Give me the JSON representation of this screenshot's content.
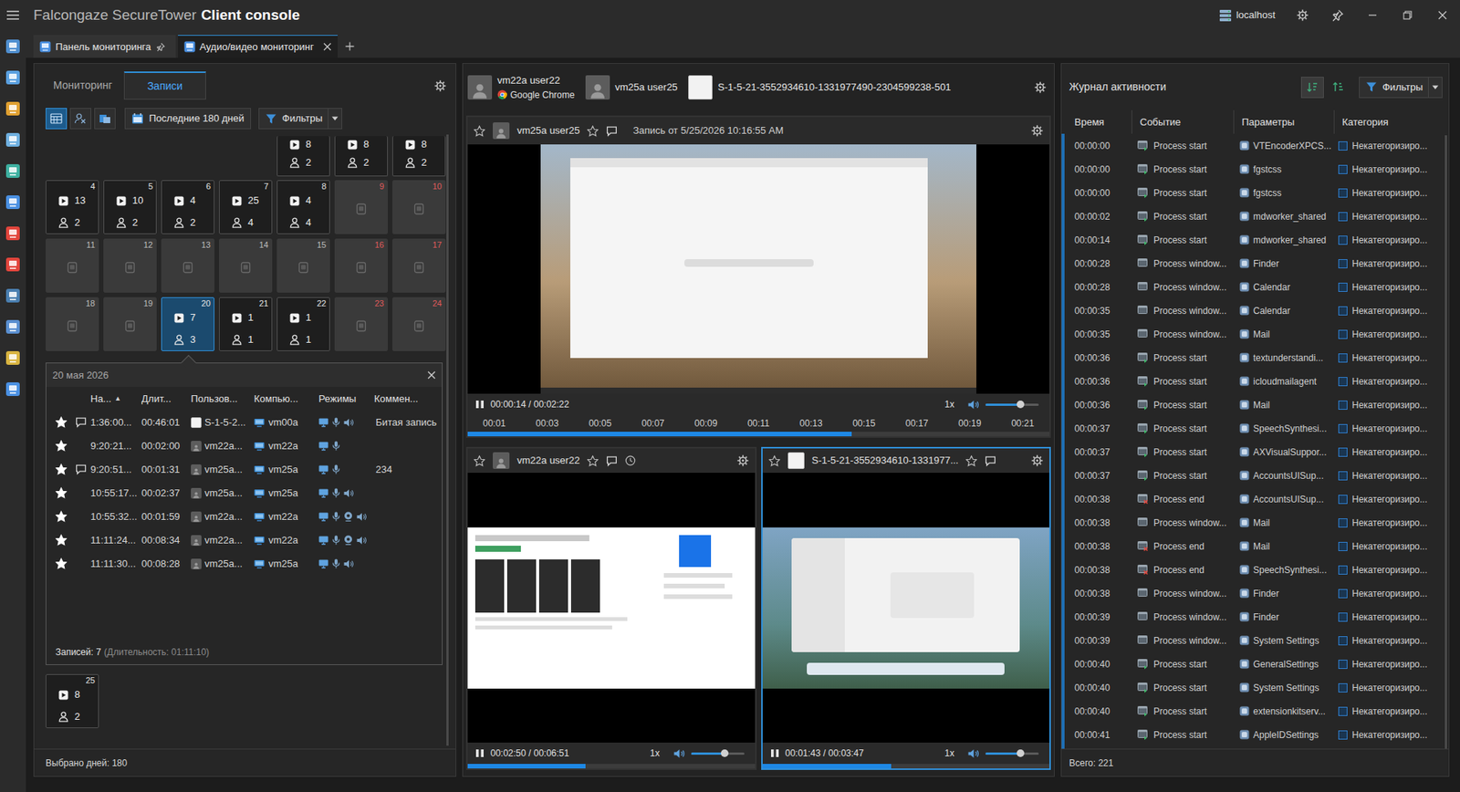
{
  "window": {
    "title_brand": "Falcongaze SecureTower",
    "title_app": "Client console",
    "server": "localhost"
  },
  "tabs": [
    {
      "label": "Панель мониторинга",
      "selected": false,
      "pinned": true,
      "closable": false
    },
    {
      "label": "Аудио/видео мониторинг",
      "selected": true,
      "pinned": false,
      "closable": true
    }
  ],
  "records_panel": {
    "modes": [
      {
        "label": "Мониторинг",
        "selected": false
      },
      {
        "label": "Записи",
        "selected": true
      }
    ],
    "view_buttons": [
      {
        "selected": true
      },
      {
        "selected": false
      },
      {
        "selected": false
      }
    ],
    "period": "Последние 180 дней",
    "filters": "Фильтры",
    "calendar": {
      "weeks": [
        [
          {
            "kind": "blank"
          },
          {
            "kind": "blank"
          },
          {
            "kind": "blank"
          },
          {
            "kind": "blank"
          },
          {
            "kind": "partial",
            "videos": "8",
            "users": "2",
            "selected": false
          },
          {
            "kind": "partial",
            "videos": "8",
            "users": "2",
            "selected": false
          },
          {
            "kind": "partial",
            "videos": "8",
            "users": "2",
            "selected": false
          }
        ],
        [
          {
            "kind": "records",
            "day": "4",
            "videos": "13",
            "users": "2",
            "weekend": false,
            "selected": false
          },
          {
            "kind": "records",
            "day": "5",
            "videos": "10",
            "users": "2",
            "weekend": false,
            "selected": false
          },
          {
            "kind": "records",
            "day": "6",
            "videos": "4",
            "users": "2",
            "weekend": false,
            "selected": false
          },
          {
            "kind": "records",
            "day": "7",
            "videos": "25",
            "users": "4",
            "weekend": false,
            "selected": false
          },
          {
            "kind": "records",
            "day": "8",
            "videos": "4",
            "users": "4",
            "weekend": false,
            "selected": false
          },
          {
            "kind": "empty",
            "day": "9",
            "weekend": true,
            "selected": false
          },
          {
            "kind": "empty",
            "day": "10",
            "weekend": true,
            "selected": false
          }
        ],
        [
          {
            "kind": "empty",
            "day": "11",
            "weekend": false,
            "selected": false
          },
          {
            "kind": "empty",
            "day": "12",
            "weekend": false,
            "selected": false
          },
          {
            "kind": "empty",
            "day": "13",
            "weekend": false,
            "selected": false
          },
          {
            "kind": "empty",
            "day": "14",
            "weekend": false,
            "selected": false
          },
          {
            "kind": "empty",
            "day": "15",
            "weekend": false,
            "selected": false
          },
          {
            "kind": "empty",
            "day": "16",
            "weekend": true,
            "selected": false
          },
          {
            "kind": "empty",
            "day": "17",
            "weekend": true,
            "selected": false
          }
        ],
        [
          {
            "kind": "empty",
            "day": "18",
            "weekend": false,
            "selected": false
          },
          {
            "kind": "empty",
            "day": "19",
            "weekend": false,
            "selected": false
          },
          {
            "kind": "records",
            "day": "20",
            "videos": "7",
            "users": "3",
            "weekend": false,
            "selected": true
          },
          {
            "kind": "records",
            "day": "21",
            "videos": "1",
            "users": "1",
            "weekend": false,
            "selected": false
          },
          {
            "kind": "records",
            "day": "22",
            "videos": "1",
            "users": "1",
            "weekend": false,
            "selected": false
          },
          {
            "kind": "empty",
            "day": "23",
            "weekend": true,
            "selected": false
          },
          {
            "kind": "empty",
            "day": "24",
            "weekend": true,
            "selected": false
          }
        ],
        [
          {
            "kind": "records",
            "day": "25",
            "videos": "8",
            "users": "2",
            "weekend": false,
            "selected": false
          }
        ]
      ]
    },
    "day_detail": {
      "title": "20 мая 2026",
      "columns": [
        {
          "label": "На...",
          "sort": "▲"
        },
        {
          "label": "Длит..."
        },
        {
          "label": "Пользов..."
        },
        {
          "label": "Компью..."
        },
        {
          "label": "Режимы"
        },
        {
          "label": "Коммен..."
        }
      ],
      "rows": [
        {
          "starred": true,
          "commented": true,
          "start": "1:36:00...",
          "duration": "00:46:01",
          "avatar": "light",
          "user": "S-1-5-2...",
          "computer": "vm00a",
          "modes": [
            "screen",
            "mic",
            "speaker"
          ],
          "comment": "Битая запись"
        },
        {
          "starred": true,
          "commented": false,
          "start": "9:20:21...",
          "duration": "00:02:00",
          "avatar": "dark",
          "user": "vm22a...",
          "computer": "vm22a",
          "modes": [
            "screen",
            "mic"
          ],
          "comment": ""
        },
        {
          "starred": true,
          "commented": true,
          "start": "9:20:51...",
          "duration": "00:01:31",
          "avatar": "dark",
          "user": "vm25a...",
          "computer": "vm25a",
          "modes": [
            "screen",
            "mic"
          ],
          "comment": "234"
        },
        {
          "starred": true,
          "commented": false,
          "start": "10:55:17...",
          "duration": "00:02:37",
          "avatar": "dark",
          "user": "vm25a...",
          "computer": "vm25a",
          "modes": [
            "screen",
            "mic",
            "speaker"
          ],
          "comment": ""
        },
        {
          "starred": true,
          "commented": false,
          "start": "10:55:32...",
          "duration": "00:01:59",
          "avatar": "dark",
          "user": "vm22a...",
          "computer": "vm22a",
          "modes": [
            "screen",
            "mic",
            "camera",
            "speaker"
          ],
          "comment": ""
        },
        {
          "starred": true,
          "commented": false,
          "start": "11:11:24...",
          "duration": "00:08:34",
          "avatar": "dark",
          "user": "vm22a...",
          "computer": "vm22a",
          "modes": [
            "screen",
            "mic",
            "camera",
            "speaker"
          ],
          "comment": ""
        },
        {
          "starred": true,
          "commented": false,
          "start": "11:11:30...",
          "duration": "00:08:28",
          "avatar": "dark",
          "user": "vm25a...",
          "computer": "vm25a",
          "modes": [
            "screen",
            "mic",
            "speaker"
          ],
          "comment": ""
        }
      ],
      "footer_count": "Записей: 7",
      "footer_duration": "(Длительность: 01:11:10)"
    },
    "footer": "Выбрано дней: 180"
  },
  "sessions": [
    {
      "name": "vm22a user22",
      "app": "Google Chrome",
      "avatar": "dark"
    },
    {
      "name": "vm25a user25",
      "avatar": "dark"
    },
    {
      "name": "S-1-5-21-3552934610-1331977490-2304599238-501",
      "avatar": "light"
    }
  ],
  "players": [
    {
      "user": "vm25a user25",
      "avatar": "dark",
      "star_user": false,
      "star_record": false,
      "clock": false,
      "title": "Запись от 5/25/2026 10:16:55 AM",
      "kind": "landscape",
      "playing": true,
      "time": "00:00:14 / 00:02:22",
      "speed": "1x",
      "volume": 0.65,
      "progress": 0.66,
      "selected": false,
      "ticks": [
        "00:01",
        "00:03",
        "00:05",
        "00:07",
        "00:09",
        "00:11",
        "00:13",
        "00:15",
        "00:17",
        "00:19",
        "00:21"
      ]
    },
    {
      "user": "vm22a user22",
      "avatar": "dark",
      "star_user": false,
      "star_record": false,
      "clock": true,
      "kind": "page",
      "playing": true,
      "time": "00:02:50 / 00:06:51",
      "speed": "1x",
      "volume": 0.63,
      "progress": 0.41,
      "selected": false
    },
    {
      "user": "S-1-5-21-3552934610-1331977...",
      "avatar": "light",
      "star_user": false,
      "star_record": false,
      "clock": false,
      "kind": "mac",
      "playing": true,
      "time": "00:01:43 / 00:03:47",
      "speed": "1x",
      "volume": 0.65,
      "progress": 0.45,
      "selected": true
    }
  ],
  "activity": {
    "title": "Журнал активности",
    "sort_buttons": [
      {
        "selected": true
      },
      {
        "selected": false
      }
    ],
    "filters": "Фильтры",
    "columns": [
      "Время",
      "Событие",
      "Параметры",
      "Категория"
    ],
    "rows": [
      {
        "time": "00:00:00",
        "event": "Process start",
        "kind": "start",
        "param": "VTEncoderXPCS...",
        "category": "Некатегоризиро..."
      },
      {
        "time": "00:00:00",
        "event": "Process start",
        "kind": "start",
        "param": "fgstcss",
        "category": "Некатегоризиро..."
      },
      {
        "time": "00:00:00",
        "event": "Process start",
        "kind": "start",
        "param": "fgstcss",
        "category": "Некатегоризиро..."
      },
      {
        "time": "00:00:02",
        "event": "Process start",
        "kind": "start",
        "param": "mdworker_shared",
        "category": "Некатегоризиро..."
      },
      {
        "time": "00:00:14",
        "event": "Process start",
        "kind": "start",
        "param": "mdworker_shared",
        "category": "Некатегоризиро..."
      },
      {
        "time": "00:00:28",
        "event": "Process window...",
        "kind": "window",
        "param": "Finder",
        "category": "Некатегоризиро..."
      },
      {
        "time": "00:00:28",
        "event": "Process window...",
        "kind": "window",
        "param": "Calendar",
        "category": "Некатегоризиро..."
      },
      {
        "time": "00:00:35",
        "event": "Process window...",
        "kind": "window",
        "param": "Calendar",
        "category": "Некатегоризиро..."
      },
      {
        "time": "00:00:35",
        "event": "Process window...",
        "kind": "window",
        "param": "Mail",
        "category": "Некатегоризиро..."
      },
      {
        "time": "00:00:36",
        "event": "Process start",
        "kind": "start",
        "param": "textunderstandi...",
        "category": "Некатегоризиро..."
      },
      {
        "time": "00:00:36",
        "event": "Process start",
        "kind": "start",
        "param": "icloudmailagent",
        "category": "Некатегоризиро..."
      },
      {
        "time": "00:00:36",
        "event": "Process start",
        "kind": "start",
        "param": "Mail",
        "category": "Некатегоризиро..."
      },
      {
        "time": "00:00:37",
        "event": "Process start",
        "kind": "start",
        "param": "SpeechSynthesi...",
        "category": "Некатегоризиро..."
      },
      {
        "time": "00:00:37",
        "event": "Process start",
        "kind": "start",
        "param": "AXVisualSuppor...",
        "category": "Некатегоризиро..."
      },
      {
        "time": "00:00:37",
        "event": "Process start",
        "kind": "start",
        "param": "AccountsUISup...",
        "category": "Некатегоризиро..."
      },
      {
        "time": "00:00:38",
        "event": "Process end",
        "kind": "end",
        "param": "AccountsUISup...",
        "category": "Некатегоризиро..."
      },
      {
        "time": "00:00:38",
        "event": "Process window...",
        "kind": "window",
        "param": "Mail",
        "category": "Некатегоризиро..."
      },
      {
        "time": "00:00:38",
        "event": "Process end",
        "kind": "end",
        "param": "Mail",
        "category": "Некатегоризиро..."
      },
      {
        "time": "00:00:38",
        "event": "Process end",
        "kind": "end",
        "param": "SpeechSynthesi...",
        "category": "Некатегоризиро..."
      },
      {
        "time": "00:00:38",
        "event": "Process window...",
        "kind": "window",
        "param": "Finder",
        "category": "Некатегоризиро..."
      },
      {
        "time": "00:00:39",
        "event": "Process window...",
        "kind": "window",
        "param": "Finder",
        "category": "Некатегоризиро..."
      },
      {
        "time": "00:00:39",
        "event": "Process window...",
        "kind": "window",
        "param": "System Settings",
        "category": "Некатегоризиро..."
      },
      {
        "time": "00:00:40",
        "event": "Process start",
        "kind": "start",
        "param": "GeneralSettings",
        "category": "Некатегоризиро..."
      },
      {
        "time": "00:00:40",
        "event": "Process start",
        "kind": "start",
        "param": "System Settings",
        "category": "Некатегоризиро..."
      },
      {
        "time": "00:00:40",
        "event": "Process start",
        "kind": "start",
        "param": "extensionkitserv...",
        "category": "Некатегоризиро..."
      },
      {
        "time": "00:00:41",
        "event": "Process start",
        "kind": "start",
        "param": "AppleIDSettings",
        "category": "Некатегоризиро..."
      }
    ],
    "total": "Всего: 221"
  }
}
